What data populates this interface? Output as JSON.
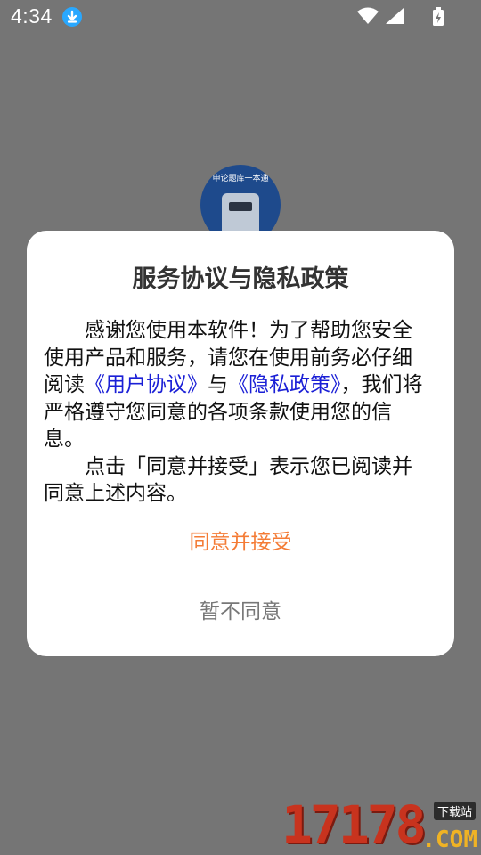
{
  "status_bar": {
    "time": "4:34",
    "icons": [
      "download-icon",
      "wifi-icon",
      "signal-icon",
      "battery-icon"
    ]
  },
  "app_logo": {
    "text": "申论题库一本通"
  },
  "dialog": {
    "title": "服务协议与隐私政策",
    "para1_before": "感谢您使用本软件！为了帮助您安全使用产品和服务，请您在使用前务必仔细阅读",
    "link_user_agreement": "《用户协议》",
    "para1_middle": "与",
    "link_privacy_policy": "《隐私政策》",
    "para1_after": "，我们将严格遵守您同意的各项条款使用您的信息。",
    "para2": "点击「同意并接受」表示您已阅读并同意上述内容。",
    "accept_label": "同意并接受",
    "decline_label": "暂不同意"
  },
  "watermark": {
    "number": "17178",
    "tag": "下载站",
    "suffix": ".COM"
  },
  "colors": {
    "overlay": "#757575",
    "accept": "#f47b35",
    "decline": "#777777",
    "link": "#1a1fd6"
  }
}
